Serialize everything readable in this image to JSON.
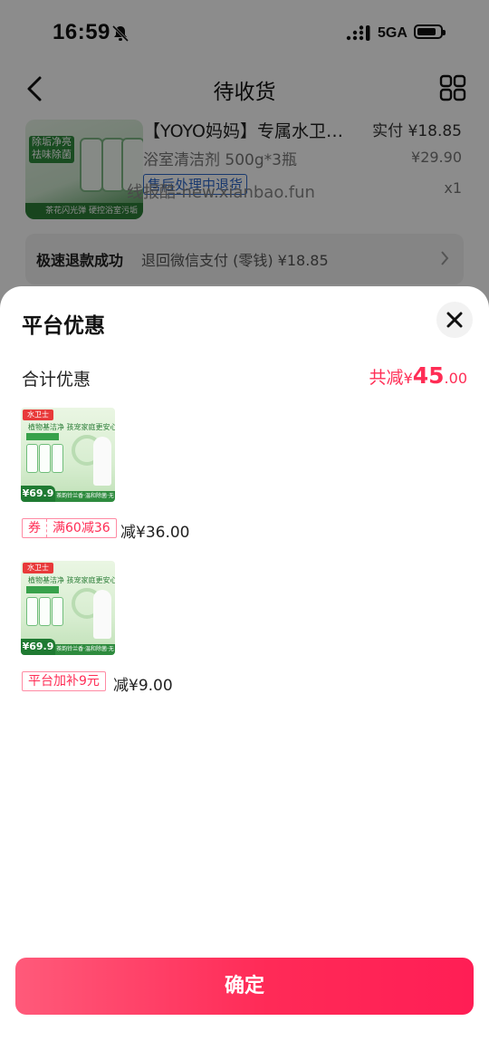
{
  "status_bar": {
    "time": "16:59",
    "network": "5GA"
  },
  "nav": {
    "title": "待收货"
  },
  "background_order": {
    "product_title": "【YOYO妈妈】专属水卫…",
    "real_pay": "实付 ¥18.85",
    "spec": "浴室清洁剂 500g*3瓶",
    "original_price": "¥29.90",
    "status_tag": "售后处理中退货",
    "quantity": "x1",
    "watermark": "线报酷-new.xianbao.fun",
    "thumb_banner": "除垢净亮 祛味除菌",
    "thumb_footer": "茶花闪光弹 硬控浴室污垢",
    "refund_label": "极速退款成功",
    "refund_detail": "退回微信支付 (零钱) ¥18.85"
  },
  "sheet": {
    "title": "平台优惠",
    "total_label": "合计优惠",
    "total_prefix": "共减",
    "total_currency": "¥",
    "total_int": "45",
    "total_dec": ".00",
    "items": [
      {
        "image": {
          "brand": "水卫士",
          "headline": "植物基洁净 孩宠家庭更安心",
          "price": "¥69.9",
          "footer": "茶韵铃兰香·温和除菌·无残留"
        },
        "coupon_kind": "券",
        "coupon_text": "满60减36",
        "reduce_text": "减¥36.00"
      },
      {
        "image": {
          "brand": "水卫士",
          "headline": "植物基洁净 孩宠家庭更安心",
          "price": "¥69.9",
          "footer": "茶韵铃兰香·温和除菌·无残留"
        },
        "coupon_text": "平台加补9元",
        "reduce_text": "减¥9.00"
      }
    ],
    "confirm_label": "确定"
  },
  "colors": {
    "accent": "#ff2d55",
    "overlay": "rgba(0,0,0,0.45)"
  }
}
